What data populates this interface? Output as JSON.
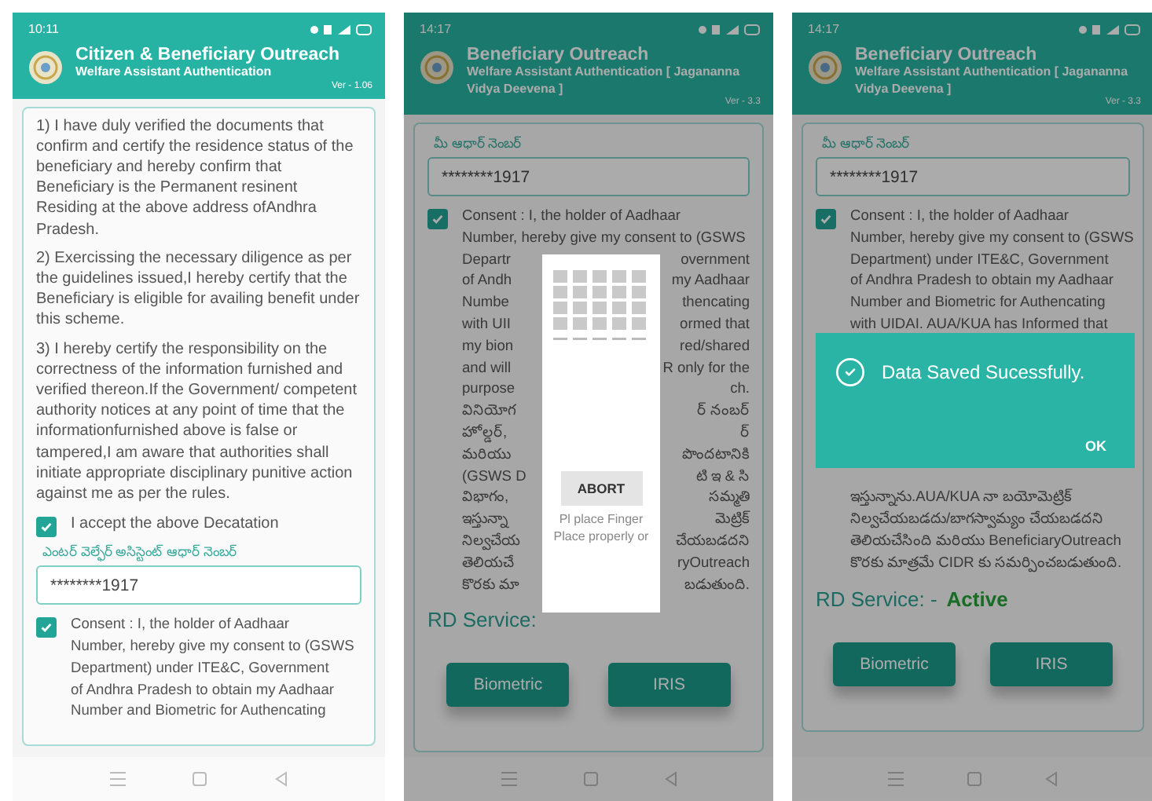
{
  "phones": [
    {
      "status_time": "10:11",
      "app_title": "Citizen & Beneficiary Outreach",
      "app_subtitle": "Welfare Assistant Authentication",
      "version": "Ver - 1.06",
      "declarations": [
        "1) I have duly verified the documents that confirm and certify the residence status of the beneficiary and hereby confirm that Beneficiary is the Permanent resinent Residing at the above address ofAndhra Pradesh.",
        "2) Exercissing the necessary diligence as per the guidelines issued,I hereby certify that the Beneficiary is eligible for availing benefit under this scheme.",
        "3) I hereby certify the responsibility on the correctness of the information furnished and verified thereon.If the Government/ competent authority notices at any point of time that the informationfurnished above is false or tampered,I am aware that authorities shall initiate appropriate disciplinary punitive action against me as per the rules."
      ],
      "accept": {
        "label": "I accept the above Decatation",
        "checked": true
      },
      "aadhaar_field": {
        "label": "ఎంటర్ వెల్ఫేర్ అసిస్టెంట్ ఆధార్ నెంబర్",
        "value": "********1917"
      },
      "consent": {
        "checked": true,
        "lines": [
          {
            "kind": "full",
            "text": "Consent : I, the holder of Aadhaar"
          },
          {
            "kind": "full",
            "text": "Number, hereby give my consent to (GSWS"
          },
          {
            "kind": "full",
            "text": "Department) under ITE&C, Government"
          },
          {
            "kind": "full",
            "text": "of Andhra Pradesh to obtain my Aadhaar"
          },
          {
            "kind": "full",
            "text": "Number and Biometric for Authencating"
          }
        ]
      }
    },
    {
      "status_time": "14:17",
      "app_title": "Beneficiary Outreach",
      "app_subtitle": "Welfare Assistant Authentication [ Jagananna Vidya Deevena ]",
      "version": "Ver - 3.3",
      "aadhaar_field": {
        "label": "మీ ఆధార్ నెంబర్",
        "value": "********1917"
      },
      "consent": {
        "checked": true,
        "lines": [
          {
            "kind": "full",
            "text": "Consent : I, the holder of Aadhaar"
          },
          {
            "kind": "full",
            "text": "Number, hereby give my consent to (GSWS"
          },
          {
            "kind": "split",
            "left": "Departr",
            "right": "overnment"
          },
          {
            "kind": "split",
            "left": "of Andh",
            "right": "my Aadhaar"
          },
          {
            "kind": "split",
            "left": "Numbe",
            "right": "thencating"
          },
          {
            "kind": "split",
            "left": "with UII",
            "right": "ormed that"
          },
          {
            "kind": "split",
            "left": "my bion",
            "right": "red/shared"
          },
          {
            "kind": "split",
            "left": "and will",
            "right": "R only for the"
          },
          {
            "kind": "split",
            "left": "purpose",
            "right": "ch."
          },
          {
            "kind": "split",
            "left": "వినియోగ",
            "right": "ర్ నంబర్"
          },
          {
            "kind": "split",
            "left": "హోల్డర్,",
            "right": "ర్"
          },
          {
            "kind": "split",
            "left": "మరియు",
            "right": "పొందటానికి"
          },
          {
            "kind": "split",
            "left": "(GSWS D",
            "right": "టి ఇ & సి"
          },
          {
            "kind": "split",
            "left": "విభాగం,",
            "right": "సమ్మతి"
          },
          {
            "kind": "split",
            "left": "ఇస్తున్నా",
            "right": "మెట్రిక్"
          },
          {
            "kind": "split",
            "left": "నిల్వచేయ",
            "right": "చేయబడదని"
          },
          {
            "kind": "split",
            "left": "తెలియచే",
            "right": "ryOutreach"
          },
          {
            "kind": "split",
            "left": "కొరకు మా",
            "right": "బడుతుంది."
          }
        ]
      },
      "rd_service": {
        "label": "RD Service:"
      },
      "buttons": [
        "Biometric",
        "IRIS"
      ],
      "dialog": {
        "kind": "fingerprint",
        "button": "ABORT",
        "message": "Pl place Finger Place properly or"
      }
    },
    {
      "status_time": "14:17",
      "app_title": "Beneficiary Outreach",
      "app_subtitle": "Welfare Assistant Authentication [ Jagananna Vidya Deevena ]",
      "version": "Ver - 3.3",
      "aadhaar_field": {
        "label": "మీ ఆధార్ నెంబర్",
        "value": "********1917"
      },
      "consent": {
        "checked": true,
        "lines": [
          {
            "kind": "full",
            "text": "Consent : I, the holder of Aadhaar"
          },
          {
            "kind": "full",
            "text": "Number, hereby give my consent to (GSWS"
          },
          {
            "kind": "full",
            "text": "Department) under ITE&C, Government"
          },
          {
            "kind": "full",
            "text": "of Andhra Pradesh to obtain my Aadhaar"
          },
          {
            "kind": "full",
            "text": "Number and Biometric for Authencating"
          },
          {
            "kind": "full",
            "text": "with UIDAI. AUA/KUA has Informed that"
          },
          {
            "kind": "gap"
          },
          {
            "kind": "gap"
          },
          {
            "kind": "gap"
          },
          {
            "kind": "gap"
          },
          {
            "kind": "gap"
          },
          {
            "kind": "gap"
          },
          {
            "kind": "gap"
          },
          {
            "kind": "full",
            "text": "ఇస్తున్నాను.AUA/KUA నా బయోమెట్రిక్"
          },
          {
            "kind": "full",
            "text": "నిల్వచేయబడదు/బాగస్వామ్యం చేయబడదని"
          },
          {
            "kind": "full",
            "text": "తెలియచేసింది మరియు BeneficiaryOutreach"
          },
          {
            "kind": "full",
            "text": "కొరకు మాత్రమే CIDR కు సమర్పించబడుతుంది."
          }
        ]
      },
      "rd_service": {
        "label": "RD Service: -",
        "status": "Active"
      },
      "buttons": [
        "Biometric",
        "IRIS"
      ],
      "dialog": {
        "kind": "message",
        "message": "Data Saved Sucessfully.",
        "button": "OK"
      }
    }
  ]
}
